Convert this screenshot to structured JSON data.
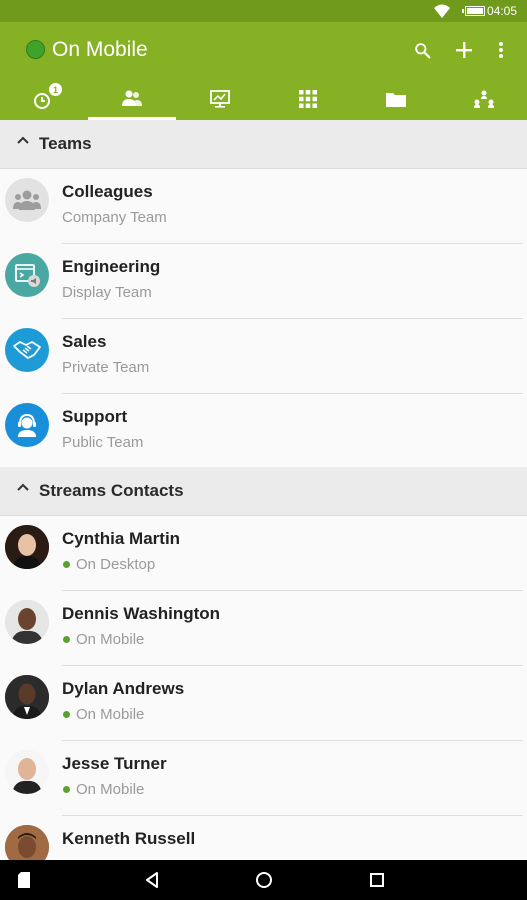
{
  "statusbar": {
    "time": "04:05",
    "icons": [
      "wifi-icon",
      "battery-icon"
    ]
  },
  "appbar": {
    "title": "On Mobile",
    "status_color": "#3fa32b",
    "accent": "#86b125",
    "actions": [
      "search-icon",
      "add-icon",
      "overflow-menu-icon"
    ],
    "tabs": [
      {
        "name": "recent",
        "icon": "recent-activity-icon",
        "badge": "1"
      },
      {
        "name": "contacts",
        "icon": "contacts-icon",
        "active": true
      },
      {
        "name": "presentation",
        "icon": "presentation-icon"
      },
      {
        "name": "apps",
        "icon": "apps-grid-icon"
      },
      {
        "name": "files",
        "icon": "folder-icon"
      },
      {
        "name": "org",
        "icon": "org-chart-icon"
      }
    ]
  },
  "teams": {
    "header": "Teams",
    "items": [
      {
        "name": "Colleagues",
        "sub": "Company Team",
        "icon": "group-icon"
      },
      {
        "name": "Engineering",
        "sub": "Display Team",
        "icon": "display-team-icon"
      },
      {
        "name": "Sales",
        "sub": "Private Team",
        "icon": "handshake-icon"
      },
      {
        "name": "Support",
        "sub": "Public Team",
        "icon": "headset-icon"
      }
    ]
  },
  "contacts": {
    "header": "Streams Contacts",
    "items": [
      {
        "name": "Cynthia Martin",
        "status": "On Desktop"
      },
      {
        "name": "Dennis Washington",
        "status": "On Mobile"
      },
      {
        "name": "Dylan Andrews",
        "status": "On Mobile"
      },
      {
        "name": "Jesse Turner",
        "status": "On Mobile"
      },
      {
        "name": "Kenneth Russell",
        "status": ""
      }
    ]
  },
  "navbar": {
    "buttons": [
      "back-icon",
      "home-icon",
      "recents-icon"
    ]
  }
}
